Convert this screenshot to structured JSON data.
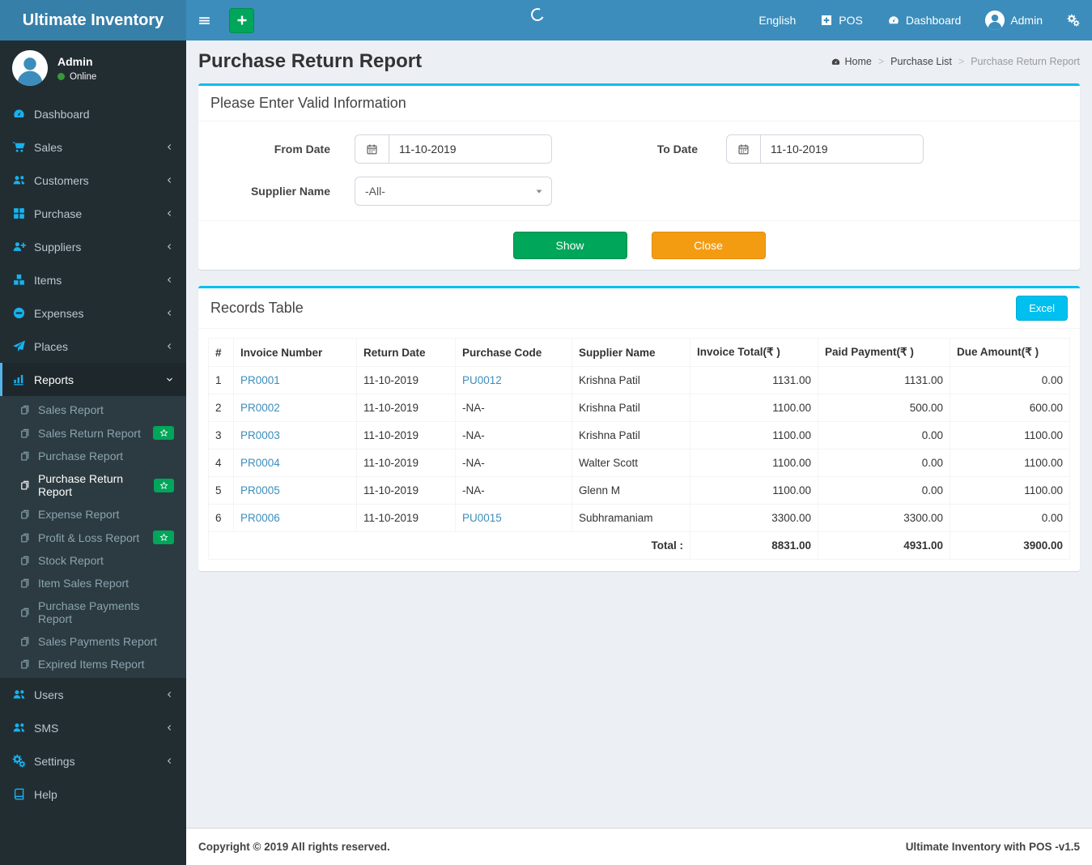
{
  "app": {
    "name": "Ultimate Inventory"
  },
  "header": {
    "nav": {
      "language": "English",
      "pos": "POS",
      "dashboard": "Dashboard",
      "user": "Admin"
    }
  },
  "sidebar": {
    "user": {
      "name": "Admin",
      "status": "Online"
    },
    "items": [
      {
        "label": "Dashboard",
        "icon": "dashboard-icon",
        "chevron": false
      },
      {
        "label": "Sales",
        "icon": "shopping-cart-icon",
        "chevron": true
      },
      {
        "label": "Customers",
        "icon": "users-icon",
        "chevron": true
      },
      {
        "label": "Purchase",
        "icon": "grid-icon",
        "chevron": true
      },
      {
        "label": "Suppliers",
        "icon": "user-plus-icon",
        "chevron": true
      },
      {
        "label": "Items",
        "icon": "cubes-icon",
        "chevron": true
      },
      {
        "label": "Expenses",
        "icon": "minus-circle-icon",
        "chevron": true
      },
      {
        "label": "Places",
        "icon": "paper-plane-icon",
        "chevron": true
      },
      {
        "label": "Reports",
        "icon": "bar-chart-icon",
        "chevron": true,
        "active": true,
        "submenu": [
          {
            "label": "Sales Report"
          },
          {
            "label": "Sales Return Report",
            "badge": "star"
          },
          {
            "label": "Purchase Report"
          },
          {
            "label": "Purchase Return Report",
            "active": true,
            "badge": "star"
          },
          {
            "label": "Expense Report"
          },
          {
            "label": "Profit & Loss Report",
            "badge": "star"
          },
          {
            "label": "Stock Report"
          },
          {
            "label": "Item Sales Report"
          },
          {
            "label": "Purchase Payments Report"
          },
          {
            "label": "Sales Payments Report"
          },
          {
            "label": "Expired Items Report"
          }
        ]
      },
      {
        "label": "Users",
        "icon": "users-icon",
        "chevron": true
      },
      {
        "label": "SMS",
        "icon": "users-icon",
        "chevron": true
      },
      {
        "label": "Settings",
        "icon": "gears-icon",
        "chevron": true
      },
      {
        "label": "Help",
        "icon": "book-icon",
        "chevron": false
      }
    ]
  },
  "page": {
    "title": "Purchase Return Report",
    "breadcrumb": {
      "home": "Home",
      "parent": "Purchase List",
      "current": "Purchase Return Report",
      "separator": ">"
    }
  },
  "filter": {
    "panel_title": "Please Enter Valid Information",
    "from_date": {
      "label": "From Date",
      "value": "11-10-2019"
    },
    "to_date": {
      "label": "To Date",
      "value": "11-10-2019"
    },
    "supplier": {
      "label": "Supplier Name",
      "value": "-All-"
    },
    "show_button": "Show",
    "close_button": "Close"
  },
  "records": {
    "panel_title": "Records Table",
    "excel_button": "Excel",
    "columns": [
      "#",
      "Invoice Number",
      "Return Date",
      "Purchase Code",
      "Supplier Name",
      "Invoice Total(₹ )",
      "Paid Payment(₹ )",
      "Due Amount(₹ )"
    ],
    "rows": [
      {
        "num": "1",
        "invoice": "PR0001",
        "return_date": "11-10-2019",
        "purchase_code": "PU0012",
        "supplier": "Krishna Patil",
        "invoice_total": "1131.00",
        "paid": "1131.00",
        "due": "0.00"
      },
      {
        "num": "2",
        "invoice": "PR0002",
        "return_date": "11-10-2019",
        "purchase_code": "-NA-",
        "supplier": "Krishna Patil",
        "invoice_total": "1100.00",
        "paid": "500.00",
        "due": "600.00"
      },
      {
        "num": "3",
        "invoice": "PR0003",
        "return_date": "11-10-2019",
        "purchase_code": "-NA-",
        "supplier": "Krishna Patil",
        "invoice_total": "1100.00",
        "paid": "0.00",
        "due": "1100.00"
      },
      {
        "num": "4",
        "invoice": "PR0004",
        "return_date": "11-10-2019",
        "purchase_code": "-NA-",
        "supplier": "Walter Scott",
        "invoice_total": "1100.00",
        "paid": "0.00",
        "due": "1100.00"
      },
      {
        "num": "5",
        "invoice": "PR0005",
        "return_date": "11-10-2019",
        "purchase_code": "-NA-",
        "supplier": "Glenn M",
        "invoice_total": "1100.00",
        "paid": "0.00",
        "due": "1100.00"
      },
      {
        "num": "6",
        "invoice": "PR0006",
        "return_date": "11-10-2019",
        "purchase_code": "PU0015",
        "supplier": "Subhramaniam",
        "invoice_total": "3300.00",
        "paid": "3300.00",
        "due": "0.00"
      }
    ],
    "total_label": "Total :",
    "totals": {
      "invoice_total": "8831.00",
      "paid": "4931.00",
      "due": "3900.00"
    }
  },
  "footer": {
    "left": "Copyright © 2019 All rights reserved.",
    "right": "Ultimate Inventory with POS -v1.5"
  },
  "colors": {
    "header": "#3c8dbc",
    "logo_bg": "#367fa9",
    "sidebar_bg": "#222d32",
    "submenu_bg": "#2c3b41",
    "accent": "#00c0ef",
    "green": "#00a65a",
    "orange": "#f39c12",
    "link": "#3c8dbc",
    "sidebar_icon": "#17b2ee"
  }
}
